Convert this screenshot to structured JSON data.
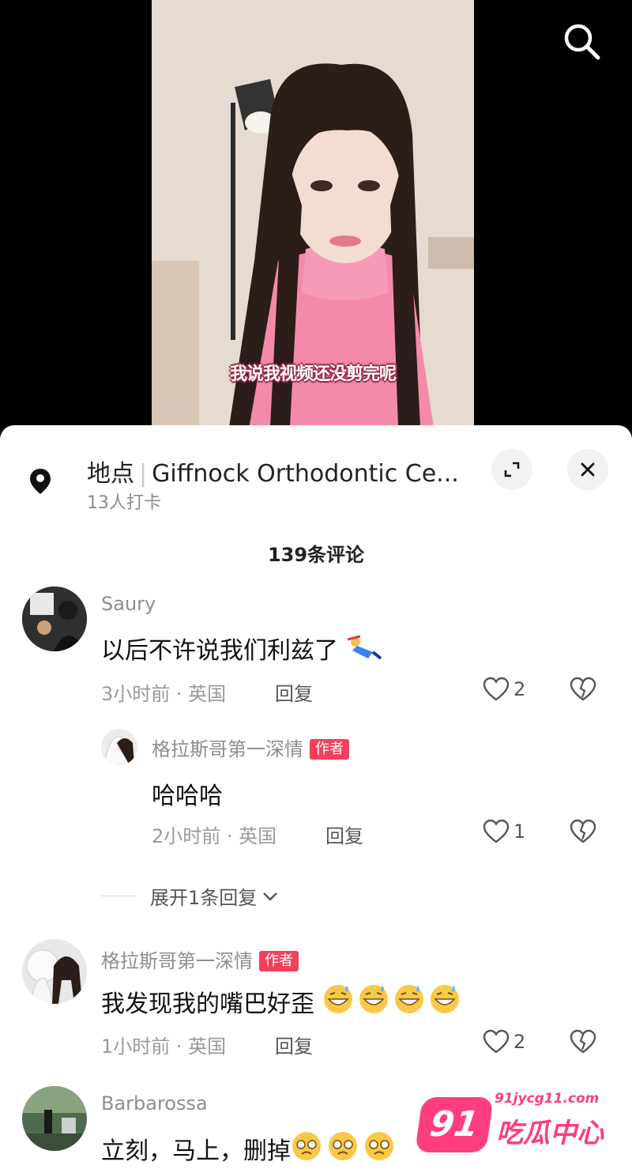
{
  "video": {
    "subtitle": "我说我视频还没剪完呢"
  },
  "header": {
    "search_icon": "search-icon"
  },
  "location": {
    "prefix": "地点",
    "name": "Giffnock Orthodontic Ce...",
    "checkins": "13人打卡",
    "pin_icon": "location-pin-icon",
    "expand_icon": "expand-icon",
    "close_icon": "close-icon"
  },
  "comments_header": {
    "count_text": "139条评论"
  },
  "comments": [
    {
      "user": "Saury",
      "text": "以后不许说我们利兹了",
      "emoji": "sliding-person-emoji",
      "time": "3小时前 · 英国",
      "reply_label": "回复",
      "likes": "2"
    },
    {
      "user": "格拉斯哥第一深情",
      "author_tag": "作者",
      "text": "哈哈哈",
      "time": "2小时前 · 英国",
      "reply_label": "回复",
      "likes": "1"
    },
    {
      "user": "格拉斯哥第一深情",
      "author_tag": "作者",
      "text": "我发现我的嘴巴好歪",
      "emoji": "grin-sweat-emoji",
      "time": "1小时前 · 英国",
      "reply_label": "回复",
      "likes": "2"
    },
    {
      "user": "Barbarossa",
      "text": "立刻，马上，删掉",
      "emoji": "pleading-emoji"
    }
  ],
  "expand_replies": {
    "label": "展开1条回复"
  },
  "watermark": {
    "badge": "91",
    "url": "91jycg11.com",
    "name": "吃瓜中心"
  },
  "colors": {
    "author_tag": "#f2405a",
    "watermark": "#ff3d7f",
    "sweater": "#f48aaa"
  }
}
